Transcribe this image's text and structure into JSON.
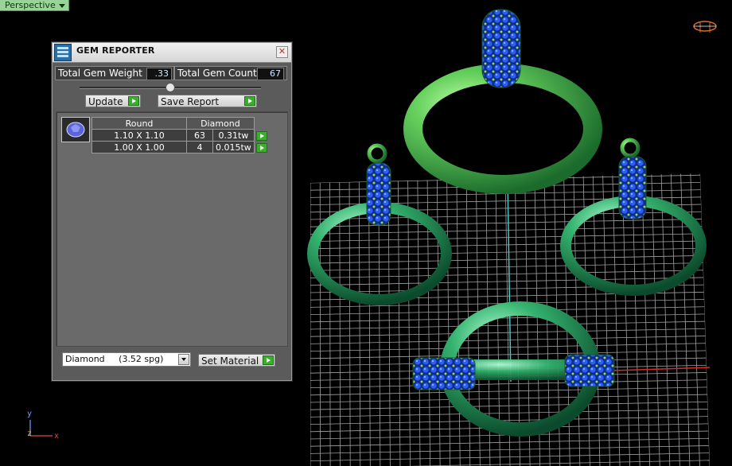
{
  "viewport": {
    "label": "Perspective",
    "axes": {
      "y": "y",
      "z": "z",
      "x": "x"
    }
  },
  "dialog": {
    "title": "GEM REPORTER",
    "close_glyph": "✕",
    "total_weight_label": "Total Gem Weight",
    "total_weight_value": ".33",
    "total_count_label": "Total Gem Count",
    "total_count_value": "67",
    "update_label": "Update",
    "save_report_label": "Save Report",
    "table": {
      "headers": [
        "Round",
        "Diamond"
      ],
      "rows": [
        {
          "size": "1.10 X 1.10",
          "count": "63",
          "weight": "0.31tw"
        },
        {
          "size": "1.00 X 1.00",
          "count": "4",
          "weight": "0.015tw"
        }
      ]
    },
    "material_selected": "Diamond     (3.52 spg)",
    "set_material_label": "Set Material"
  },
  "colors": {
    "viewport_bg": "#000000",
    "grid_line": "#bfbfbf",
    "ring_green": "#3fb047",
    "gem_blue": "#1846c8",
    "prong_green": "#9cd06a",
    "go_button": "#3cae2e"
  },
  "icons": [
    "gem-reporter-app-icon",
    "close-icon",
    "round-gem-icon",
    "dropdown-arrow-icon",
    "go-arrow-icon",
    "camera-icon"
  ]
}
